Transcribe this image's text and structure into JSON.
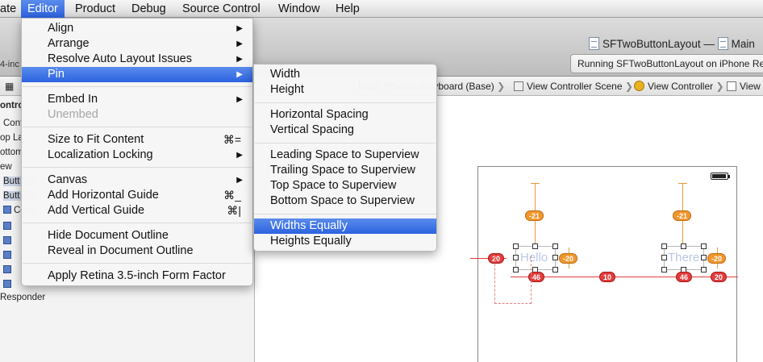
{
  "menubar": {
    "items": [
      "ate",
      "Editor",
      "Product",
      "Debug",
      "Source Control",
      "Window",
      "Help"
    ]
  },
  "toolbar": {
    "title": "SFTwoButtonLayout",
    "title_sep": "—",
    "title_second": "Main",
    "status": "Running SFTwoButtonLayout on iPhone Retina",
    "left_cut": "4-inc"
  },
  "jumpbar": {
    "storyboard": "Main_iPhone.storyboard (Base)",
    "scene": "View Controller Scene",
    "controller": "View Controller",
    "view": "View"
  },
  "outline": {
    "rows": [
      "ontro",
      "Cont",
      "op La",
      "ottom",
      "ew",
      "Butt",
      "Butt",
      "Cons",
      "",
      "",
      "",
      "",
      "",
      "Responder"
    ]
  },
  "editor_menu": {
    "items": [
      {
        "label": "Align",
        "submenu": true
      },
      {
        "label": "Arrange",
        "submenu": true
      },
      {
        "label": "Resolve Auto Layout Issues",
        "submenu": true
      },
      {
        "label": "Pin",
        "submenu": true
      },
      {
        "label": "Embed In",
        "submenu": true
      },
      {
        "label": "Unembed"
      },
      {
        "label": "Size to Fit Content",
        "shortcut": "⌘="
      },
      {
        "label": "Localization Locking",
        "submenu": true
      },
      {
        "label": "Canvas",
        "submenu": true
      },
      {
        "label": "Add Horizontal Guide",
        "shortcut": "⌘_"
      },
      {
        "label": "Add Vertical Guide",
        "shortcut": "⌘|"
      },
      {
        "label": "Hide Document Outline"
      },
      {
        "label": "Reveal in Document Outline"
      },
      {
        "label": "Apply Retina 3.5-inch Form Factor"
      }
    ]
  },
  "pin_menu": {
    "items": [
      {
        "label": "Width"
      },
      {
        "label": "Height"
      },
      {
        "label": "Horizontal Spacing"
      },
      {
        "label": "Vertical Spacing"
      },
      {
        "label": "Leading Space to Superview"
      },
      {
        "label": "Trailing Space to Superview"
      },
      {
        "label": "Top Space to Superview"
      },
      {
        "label": "Bottom Space to Superview"
      },
      {
        "label": "Widths Equally"
      },
      {
        "label": "Heights Equally"
      }
    ]
  },
  "canvas": {
    "button1_label": "Hello",
    "button2_label": "There",
    "badges": {
      "top1": "-21",
      "top2": "-21",
      "left1": "20",
      "right1": "-20",
      "right2": "-20",
      "width1": "46",
      "gap": "10",
      "width2": "46",
      "trail": "20"
    }
  },
  "colors": {
    "accent": "#2c62e0",
    "constraint_orange": "#f0962c",
    "constraint_red": "#e23c3c"
  }
}
